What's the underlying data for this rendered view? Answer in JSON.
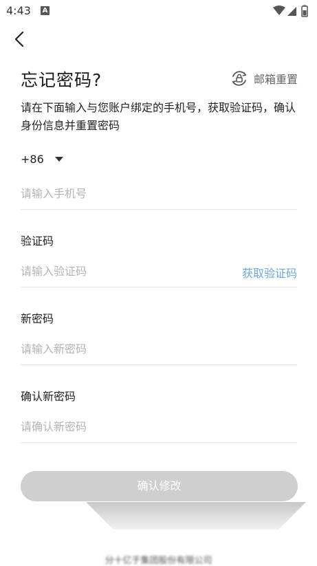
{
  "status_bar": {
    "time": "4:43",
    "notif_letter": "A"
  },
  "header": {
    "title": "忘记密码?",
    "email_reset_label": "邮箱重置",
    "description": "请在下面输入与您账户绑定的手机号，获取验证码，确认身份信息并重置密码"
  },
  "phone": {
    "country_code": "+86",
    "placeholder": "请输入手机号",
    "value": ""
  },
  "code": {
    "label": "验证码",
    "placeholder": "请输入验证码",
    "value": "",
    "get_code_label": "获取验证码"
  },
  "new_password": {
    "label": "新密码",
    "placeholder": "请输入新密码",
    "value": ""
  },
  "confirm_password": {
    "label": "确认新密码",
    "placeholder": "请确认新密码",
    "value": ""
  },
  "confirm_button": {
    "label": "确认修改",
    "enabled": false
  },
  "footer": {
    "text": "分十亿于集团股份有限公司"
  },
  "colors": {
    "accent_link": "#6ea7d8",
    "button_disabled": "#cfcfcf",
    "divider": "#e6e6e6"
  },
  "icons": [
    "signal-icon",
    "battery-icon",
    "wifi-icon",
    "back-arrow-icon",
    "lock-refresh-icon",
    "dropdown-arrow-icon"
  ]
}
